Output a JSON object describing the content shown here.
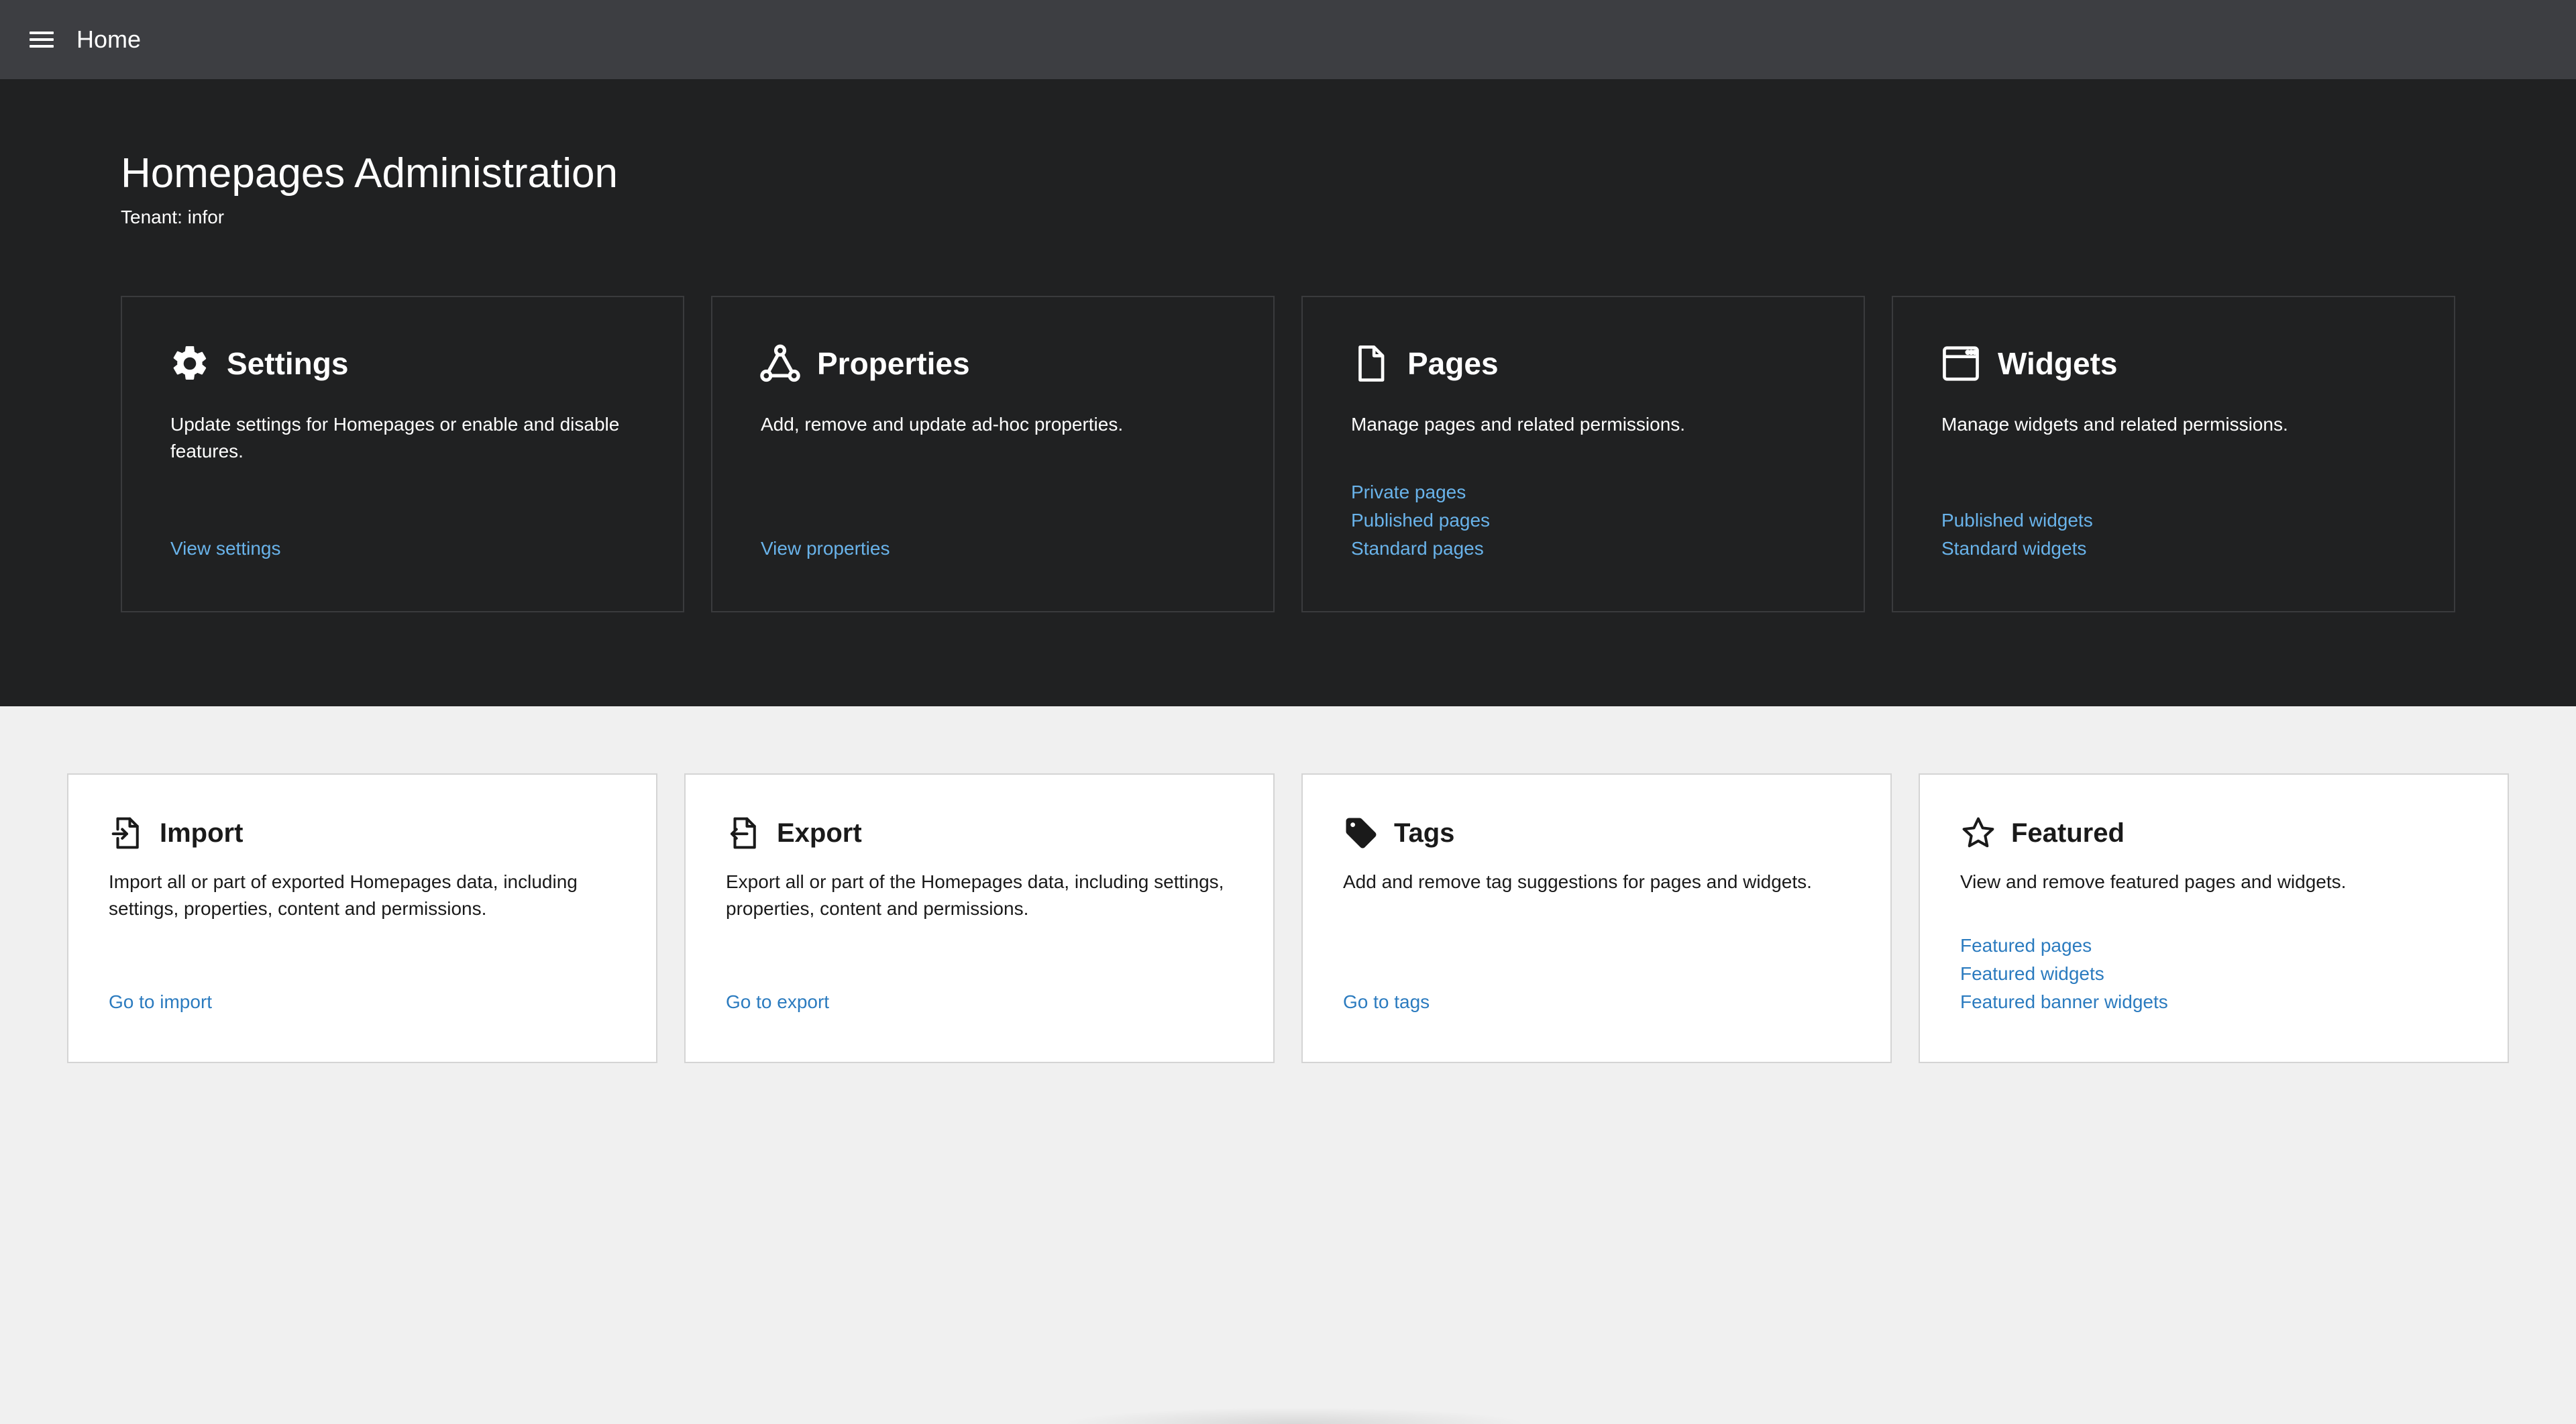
{
  "header": {
    "title": "Home",
    "menu_icon": "hamburger-menu-icon",
    "bg_color": "#3d3e42"
  },
  "hero": {
    "title": "Homepages Administration",
    "tenant": "Tenant: infor",
    "bg_color": "#202122",
    "cards": [
      {
        "id": "settings",
        "icon": "gear-icon",
        "title": "Settings",
        "description": "Update settings for Homepages or enable and disable features.",
        "links": [
          "View settings"
        ]
      },
      {
        "id": "properties",
        "icon": "nodes-triangle-icon",
        "title": "Properties",
        "description": "Add, remove and update ad-hoc properties.",
        "links": [
          "View properties"
        ]
      },
      {
        "id": "pages",
        "icon": "document-icon",
        "title": "Pages",
        "description": "Manage pages and related permissions.",
        "links": [
          "Private pages",
          "Published pages",
          "Standard pages"
        ]
      },
      {
        "id": "widgets",
        "icon": "window-icon",
        "title": "Widgets",
        "description": "Manage widgets and related permissions.",
        "links": [
          "Published widgets",
          "Standard widgets"
        ]
      }
    ]
  },
  "tools": {
    "cards": [
      {
        "id": "import",
        "icon": "file-import-icon",
        "title": "Import",
        "description": "Import all or part of exported Homepages data, including settings, properties, content and permissions.",
        "links": [
          "Go to import"
        ]
      },
      {
        "id": "export",
        "icon": "file-export-icon",
        "title": "Export",
        "description": "Export all or part of the Homepages data, including settings, properties, content and permissions.",
        "links": [
          "Go to export"
        ]
      },
      {
        "id": "tags",
        "icon": "tag-icon",
        "title": "Tags",
        "description": "Add and remove tag suggestions for pages and widgets.",
        "links": [
          "Go to tags"
        ]
      },
      {
        "id": "featured",
        "icon": "star-icon",
        "title": "Featured",
        "description": "View and remove featured pages and widgets.",
        "links": [
          "Featured pages",
          "Featured widgets",
          "Featured banner widgets"
        ]
      }
    ]
  },
  "colors": {
    "dark_link": "#69b3ea",
    "light_link": "#2b7bbf",
    "page_bg": "#f0f0f0"
  }
}
